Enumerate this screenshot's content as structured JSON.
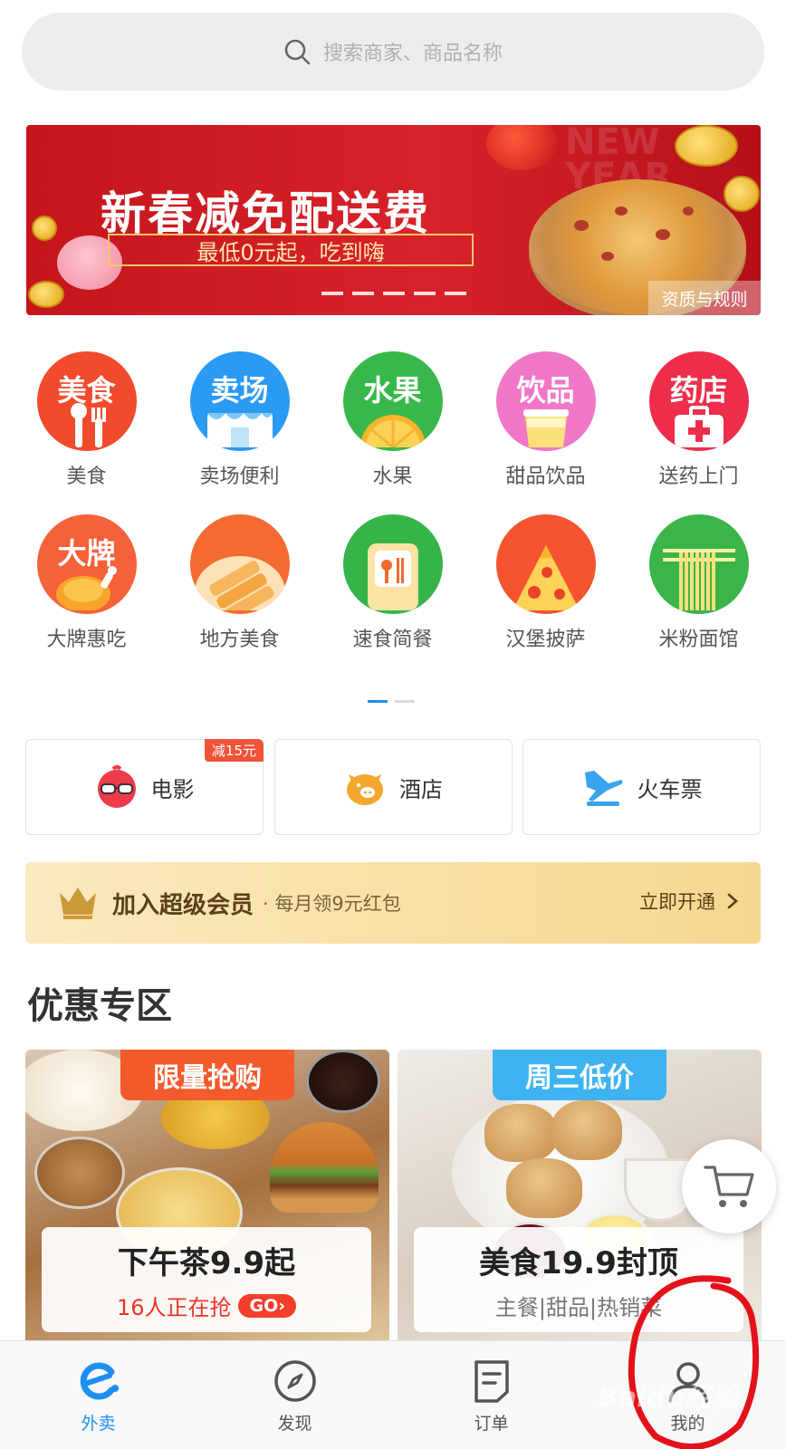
{
  "search": {
    "placeholder": "搜索商家、商品名称",
    "icon": "search-icon"
  },
  "banner": {
    "title": "新春减免配送费",
    "subtitle": "最低0元起，吃到嗨",
    "decor_text": "NEW YEAR",
    "rules_label": "资质与规则",
    "slide_count": 5
  },
  "categories": {
    "row1": [
      {
        "label": "美食",
        "circle_text": "美食",
        "icon": "utensils-icon",
        "color": "#f24a2c"
      },
      {
        "label": "卖场便利",
        "circle_text": "卖场",
        "icon": "store-icon",
        "color": "#2a9af2"
      },
      {
        "label": "水果",
        "circle_text": "水果",
        "icon": "orange-icon",
        "color": "#38b84a"
      },
      {
        "label": "甜品饮品",
        "circle_text": "饮品",
        "icon": "drink-icon",
        "color": "#f077c7"
      },
      {
        "label": "送药上门",
        "circle_text": "药店",
        "icon": "medicine-kit-icon",
        "color": "#ee2d4b"
      }
    ],
    "row2": [
      {
        "label": "大牌惠吃",
        "circle_text": "大牌",
        "icon": "chicken-icon",
        "color": "#f5613a"
      },
      {
        "label": "地方美食",
        "circle_text": "",
        "icon": "snack-plate-icon",
        "color": "#f36b33"
      },
      {
        "label": "速食简餐",
        "circle_text": "",
        "icon": "bento-icon",
        "color": "#35b549"
      },
      {
        "label": "汉堡披萨",
        "circle_text": "",
        "icon": "pizza-icon",
        "color": "#f4542f"
      },
      {
        "label": "米粉面馆",
        "circle_text": "",
        "icon": "noodles-icon",
        "color": "#3ab54a"
      }
    ]
  },
  "services": [
    {
      "label": "电影",
      "icon": "movie-glasses-icon",
      "badge": "减15元"
    },
    {
      "label": "酒店",
      "icon": "pig-hotel-icon",
      "badge": ""
    },
    {
      "label": "火车票",
      "icon": "plane-ticket-icon",
      "badge": ""
    }
  ],
  "vip": {
    "title": "加入超级会员",
    "subtitle": "· 每月领9元红包",
    "action": "立即开通"
  },
  "section": {
    "title": "优惠专区"
  },
  "promos": [
    {
      "tag": "限量抢购",
      "tag_color": "#f35a2c",
      "headline": "下午茶9.9起",
      "sub": "16人正在抢",
      "sub_color": "#e8352a",
      "go_label": "GO›"
    },
    {
      "tag": "周三低价",
      "tag_color": "#3fb3f2",
      "headline": "美食19.9封顶",
      "sub": "主餐|甜品|热销菜",
      "sub_color": "#777777",
      "go_label": ""
    }
  ],
  "bottom_nav": [
    {
      "label": "外卖",
      "icon": "eleme-logo-icon",
      "active": true
    },
    {
      "label": "发现",
      "icon": "compass-icon",
      "active": false
    },
    {
      "label": "订单",
      "icon": "order-list-icon",
      "active": false
    },
    {
      "label": "我的",
      "icon": "user-profile-icon",
      "active": false
    }
  ],
  "watermark": "Baidu经验",
  "colors": {
    "accent": "#1e8ef3",
    "banner_red": "#c4161c",
    "annotation_red": "#e3121a"
  }
}
